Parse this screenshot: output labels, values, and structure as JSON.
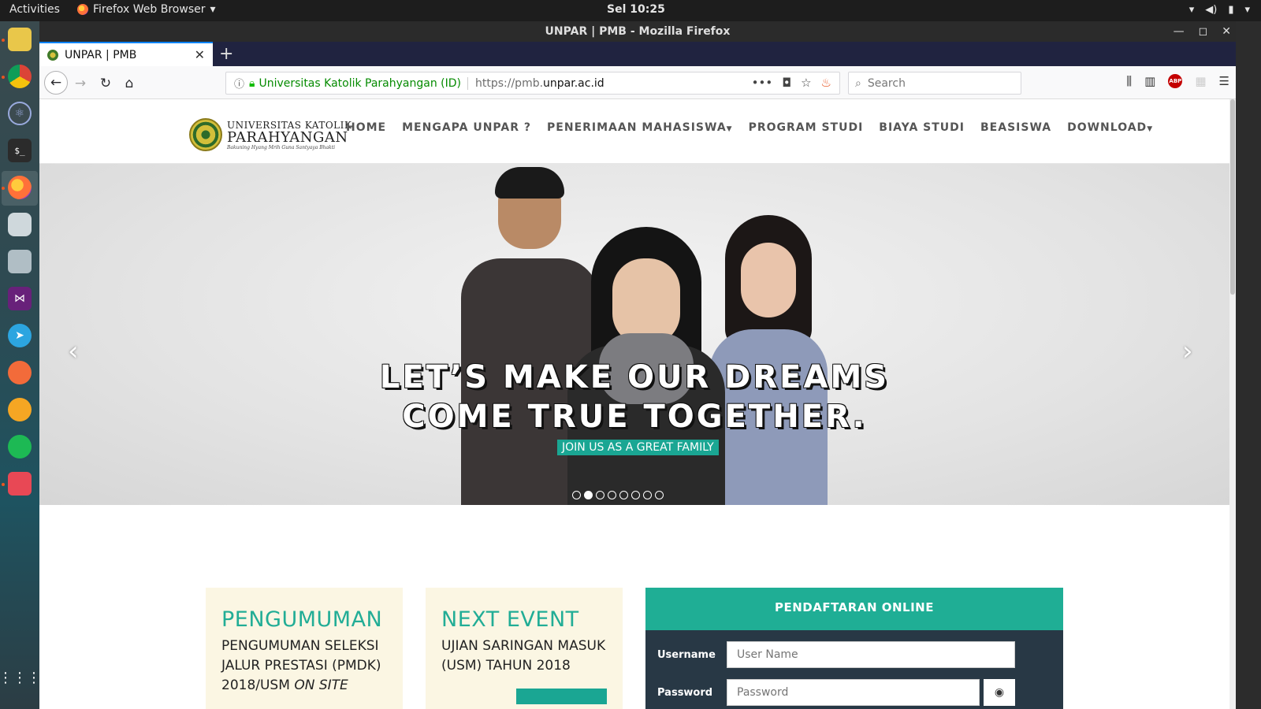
{
  "system": {
    "activities": "Activities",
    "app_menu": "Firefox Web Browser",
    "clock": "Sel 10:25"
  },
  "window": {
    "title": "UNPAR | PMB - Mozilla Firefox",
    "tab_title": "UNPAR | PMB"
  },
  "urlbar": {
    "identity": "Universitas Katolik Parahyangan (ID)",
    "url_prefix": "https://pmb.",
    "url_domain": "unpar.ac.id"
  },
  "search": {
    "placeholder": "Search"
  },
  "site": {
    "logo": {
      "line1": "UNIVERSITAS KATOLIK",
      "line2": "PARAHYANGAN",
      "line3": "Bakuning Hyang Mrih Guna Santyaya Bhakti"
    },
    "menu": [
      {
        "label": "HOME"
      },
      {
        "label": "MENGAPA UNPAR ?"
      },
      {
        "label": "PENERIMAAN MAHASISWA"
      },
      {
        "label": "PROGRAM STUDI"
      },
      {
        "label": "BIAYA STUDI"
      },
      {
        "label": "BEASISWA"
      },
      {
        "label": "DOWNLOAD"
      }
    ]
  },
  "hero": {
    "headline_line1": "LET’S MAKE OUR DREAMS",
    "headline_line2": "COME TRUE TOGETHER.",
    "subline": "JOIN US AS A GREAT FAMILY",
    "slide_count": 8,
    "active_slide": 2
  },
  "cards": {
    "announcement": {
      "heading": "PENGUMUMAN",
      "text_line1": "PENGUMUMAN SELEKSI",
      "text_line2": "JALUR PRESTASI (PMDK)",
      "text_line3": "2018/USM",
      "text_italic": "ON SITE"
    },
    "event": {
      "heading": "NEXT EVENT",
      "text_line1": "UJIAN SARINGAN MASUK",
      "text_line2": "(USM) TAHUN 2018"
    }
  },
  "registration": {
    "title": "PENDAFTARAN ONLINE",
    "username_label": "Username",
    "username_placeholder": "User Name",
    "password_label": "Password",
    "password_placeholder": "Password"
  },
  "colors": {
    "accent_teal": "#1fae95",
    "card_bg": "#fbf6e3",
    "panel_bg": "#283845"
  }
}
